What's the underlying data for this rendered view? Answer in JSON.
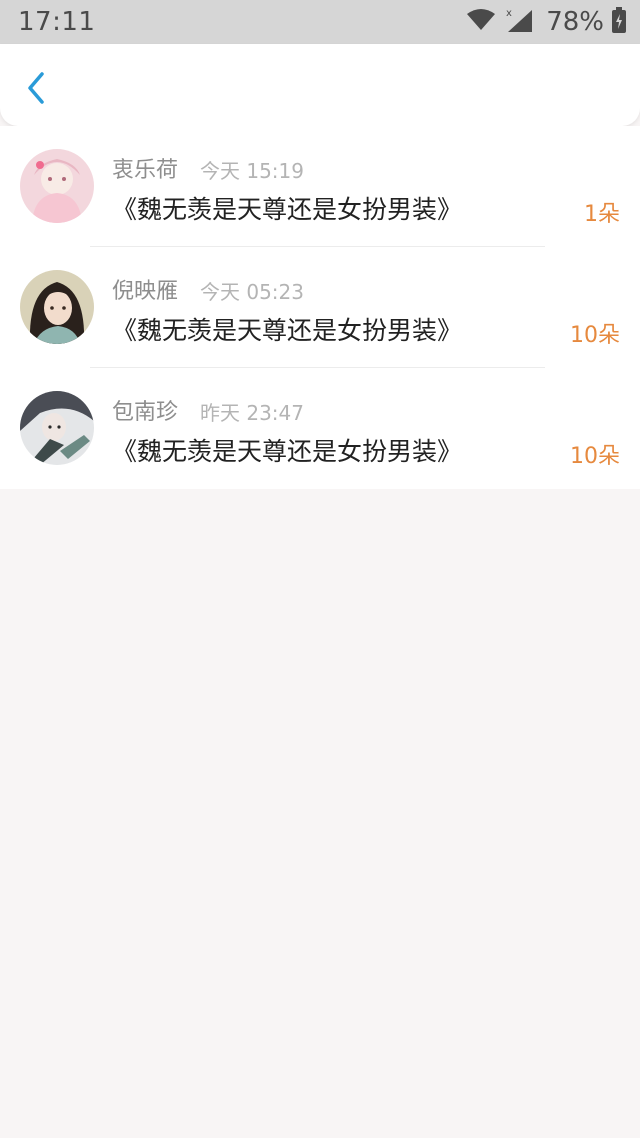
{
  "status_bar": {
    "time": "17:11",
    "battery": "78%",
    "icons": [
      "wifi-icon",
      "cell-signal-icon",
      "battery-charging-icon"
    ]
  },
  "header": {
    "back_icon": "chevron-left-icon",
    "accent_color": "#2a9bd8"
  },
  "list": {
    "items": [
      {
        "name": "衷乐荷",
        "time": "今天 15:19",
        "title": "《魏无羡是天尊还是女扮男装》",
        "count": "1朵"
      },
      {
        "name": "倪映雁",
        "time": "今天 05:23",
        "title": "《魏无羡是天尊还是女扮男装》",
        "count": "10朵"
      },
      {
        "name": "包南珍",
        "time": "昨天 23:47",
        "title": "《魏无羡是天尊还是女扮男装》",
        "count": "10朵"
      }
    ]
  },
  "colors": {
    "count": "#e6893e",
    "name": "#8e8e8e",
    "time": "#b4b4b4",
    "title": "#222222"
  }
}
